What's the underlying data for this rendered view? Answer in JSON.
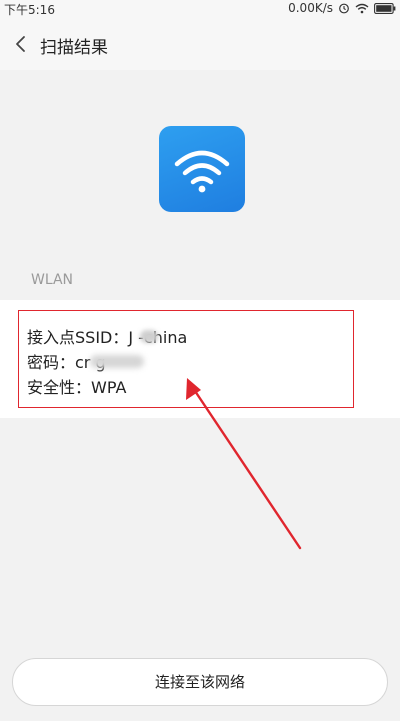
{
  "status_bar": {
    "time": "下午5:16",
    "network_speed": "0.00K/s",
    "icons": [
      "alarm-icon",
      "wifi-signal-icon",
      "battery-icon"
    ]
  },
  "header": {
    "back_icon": "chevron-left-icon",
    "title": "扫描结果"
  },
  "hero": {
    "icon": "wifi-icon",
    "accent_color": "#2b8fe8"
  },
  "section": {
    "label": "WLAN"
  },
  "network_info": {
    "ssid_line": "接入点SSID：J    -china",
    "password_line": "密码：cr      g",
    "security_line": "安全性：WPA",
    "highlight_color": "#e0262e"
  },
  "actions": {
    "connect_label": "连接至该网络"
  }
}
